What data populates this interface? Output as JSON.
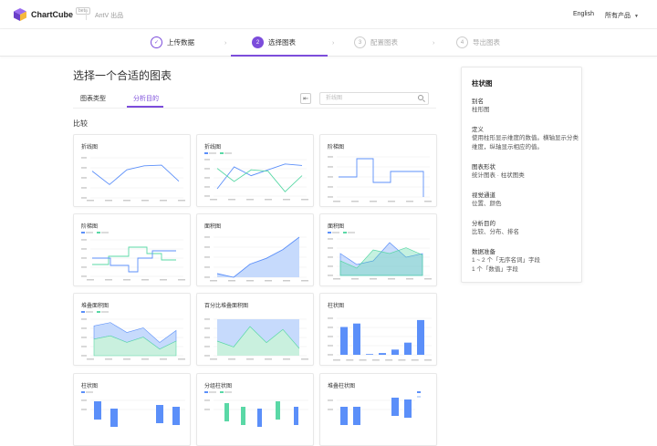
{
  "header": {
    "logo_text": "ChartCube",
    "beta": "beta",
    "antv": "AntV 出品",
    "language": "English",
    "products": "所有产品",
    "brand_color": "#7c4ddb"
  },
  "steps": [
    {
      "num": "✓",
      "label": "上传数据",
      "state": "done"
    },
    {
      "num": "2",
      "label": "选择图表",
      "state": "active"
    },
    {
      "num": "3",
      "label": "配置图表",
      "state": "todo"
    },
    {
      "num": "4",
      "label": "导出图表",
      "state": "todo"
    }
  ],
  "main": {
    "title": "选择一个合适的图表",
    "tabs": [
      "图表类型",
      "分析目的"
    ],
    "active_tab": 1,
    "search_placeholder": "折线图",
    "section": "比较"
  },
  "cards": [
    {
      "title": "折线图",
      "type": "line"
    },
    {
      "title": "折线图",
      "type": "multi-line"
    },
    {
      "title": "阶梯图",
      "type": "step"
    },
    {
      "title": "阶梯图",
      "type": "multi-step"
    },
    {
      "title": "面积图",
      "type": "area"
    },
    {
      "title": "面积图",
      "type": "multi-area"
    },
    {
      "title": "堆叠面积图",
      "type": "stacked-area"
    },
    {
      "title": "百分比堆叠面积图",
      "type": "percent-area"
    },
    {
      "title": "柱状图",
      "type": "bar"
    },
    {
      "title": "柱状图",
      "type": "grouped-bar"
    },
    {
      "title": "分组柱状图",
      "type": "group-bar2"
    },
    {
      "title": "堆叠柱状图",
      "type": "stacked-bar"
    }
  ],
  "info": {
    "title": "柱状图",
    "alias_label": "别名",
    "alias": "柱形图",
    "def_label": "定义",
    "def": "使用柱形显示维度的数值。横轴显示分类维度，纵轴显示相应的值。",
    "shape_label": "图表形状",
    "shape": "统计图表 · 柱状图类",
    "channel_label": "视觉通道",
    "channel": "位置、颜色",
    "purpose_label": "分析目的",
    "purpose": "比较、分布、排名",
    "data_label": "数据准备",
    "data1": "1 ~ 2 个「无序名词」字段",
    "data2": "1 个「数值」字段"
  },
  "colors": {
    "blue": "#5b8ff9",
    "green": "#5ad8a6",
    "lightblue": "#c6dafc",
    "lightgreen": "#c9f0de"
  }
}
